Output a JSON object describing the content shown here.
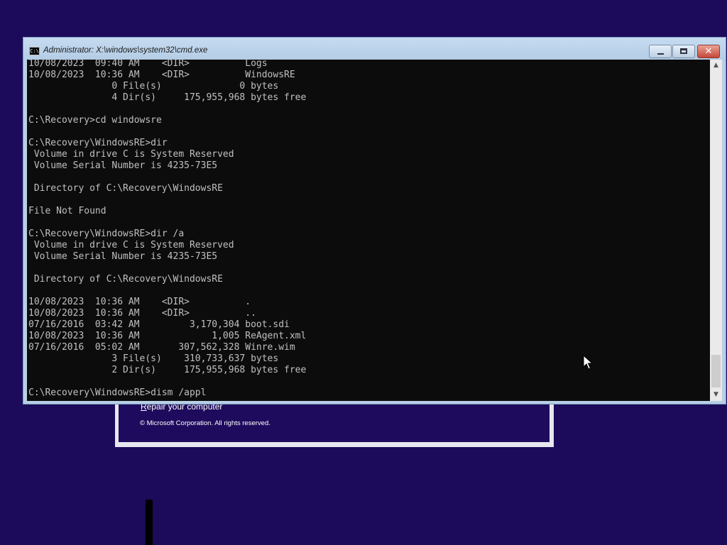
{
  "window": {
    "title": "Administrator: X:\\windows\\system32\\cmd.exe",
    "icon": "cmd-icon",
    "icon_text": "C:\\",
    "minimize_icon": "minimize-icon",
    "maximize_icon": "maximize-icon",
    "close_label": "✕"
  },
  "console": {
    "lines": [
      "10/08/2023  09:40 AM    <DIR>          Logs",
      "10/08/2023  10:36 AM    <DIR>          WindowsRE",
      "               0 File(s)              0 bytes",
      "               4 Dir(s)     175,955,968 bytes free",
      "",
      "C:\\Recovery>cd windowsre",
      "",
      "C:\\Recovery\\WindowsRE>dir",
      " Volume in drive C is System Reserved",
      " Volume Serial Number is 4235-73E5",
      "",
      " Directory of C:\\Recovery\\WindowsRE",
      "",
      "File Not Found",
      "",
      "C:\\Recovery\\WindowsRE>dir /a",
      " Volume in drive C is System Reserved",
      " Volume Serial Number is 4235-73E5",
      "",
      " Directory of C:\\Recovery\\WindowsRE",
      "",
      "10/08/2023  10:36 AM    <DIR>          .",
      "10/08/2023  10:36 AM    <DIR>          ..",
      "07/16/2016  03:42 AM         3,170,304 boot.sdi",
      "10/08/2023  10:36 AM             1,005 ReAgent.xml",
      "07/16/2016  05:02 AM       307,562,328 Winre.wim",
      "               3 File(s)    310,733,637 bytes",
      "               2 Dir(s)     175,955,968 bytes free",
      "",
      "C:\\Recovery\\WindowsRE>dism /appl"
    ]
  },
  "scrollbar": {
    "up_arrow": "▲",
    "down_arrow": "▼"
  },
  "setup": {
    "repair_link_first": "R",
    "repair_link_rest": "epair your computer",
    "copyright": "© Microsoft Corporation. All rights reserved."
  },
  "colors": {
    "desktop_bg": "#1c0a5a",
    "console_bg": "#0c0c0c",
    "console_text": "#c0c0c0"
  }
}
